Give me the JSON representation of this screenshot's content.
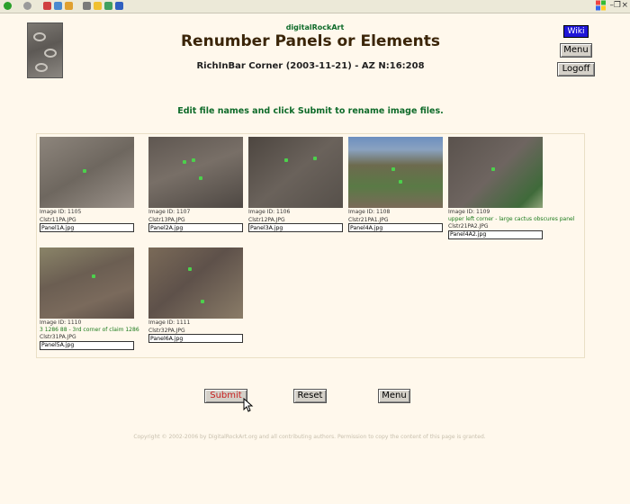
{
  "site_name": "digitalRockArt",
  "title": "Renumber Panels or Elements",
  "subtitle": "RichInBar Corner (2003-11-21) - AZ N:16:208",
  "nav": {
    "wiki": "Wiki",
    "menu": "Menu",
    "logoff": "Logoff"
  },
  "instruction": "Edit file names and click Submit to rename image files.",
  "images": [
    {
      "id_label": "Image ID: 1105",
      "description": "",
      "file": "Clstr11PA.JPG",
      "new_name": "Panel1A.jpg"
    },
    {
      "id_label": "Image ID: 1107",
      "description": "",
      "file": "Clstr13PA.JPG",
      "new_name": "Panel2A.jpg"
    },
    {
      "id_label": "Image ID: 1106",
      "description": "",
      "file": "Clstr12PA.JPG",
      "new_name": "Panel3A.jpg"
    },
    {
      "id_label": "Image ID: 1108",
      "description": "",
      "file": "Clstr21PA1.JPG",
      "new_name": "Panel4A.jpg"
    },
    {
      "id_label": "Image ID: 1109",
      "description": "upper left corner - large cactus obscures panel",
      "file": "Clstr21PA2.JPG",
      "new_name": "Panel4A2.jpg"
    },
    {
      "id_label": "Image ID: 1110",
      "description": "3 1286 88 - 3rd corner of claim 1286",
      "file": "Clstr31PA.JPG",
      "new_name": "Panel5A.jpg"
    },
    {
      "id_label": "Image ID: 1111",
      "description": "",
      "file": "Clstr32PA.JPG",
      "new_name": "Panel6A.jpg"
    }
  ],
  "buttons": {
    "submit": "Submit",
    "reset": "Reset",
    "menu": "Menu"
  },
  "copyright": "Copyright © 2002-2006 by DigitalRockArt.org and all contributing authors. Permission to copy the content of this page is granted.",
  "colors": {
    "background": "#fff8ec",
    "heading": "#3b2508",
    "accent_green": "#0f6b2a",
    "wiki_blue": "#1f16d8",
    "submit_red": "#c81e1e"
  },
  "icons": {
    "cursor": "arrow-cursor-icon"
  }
}
